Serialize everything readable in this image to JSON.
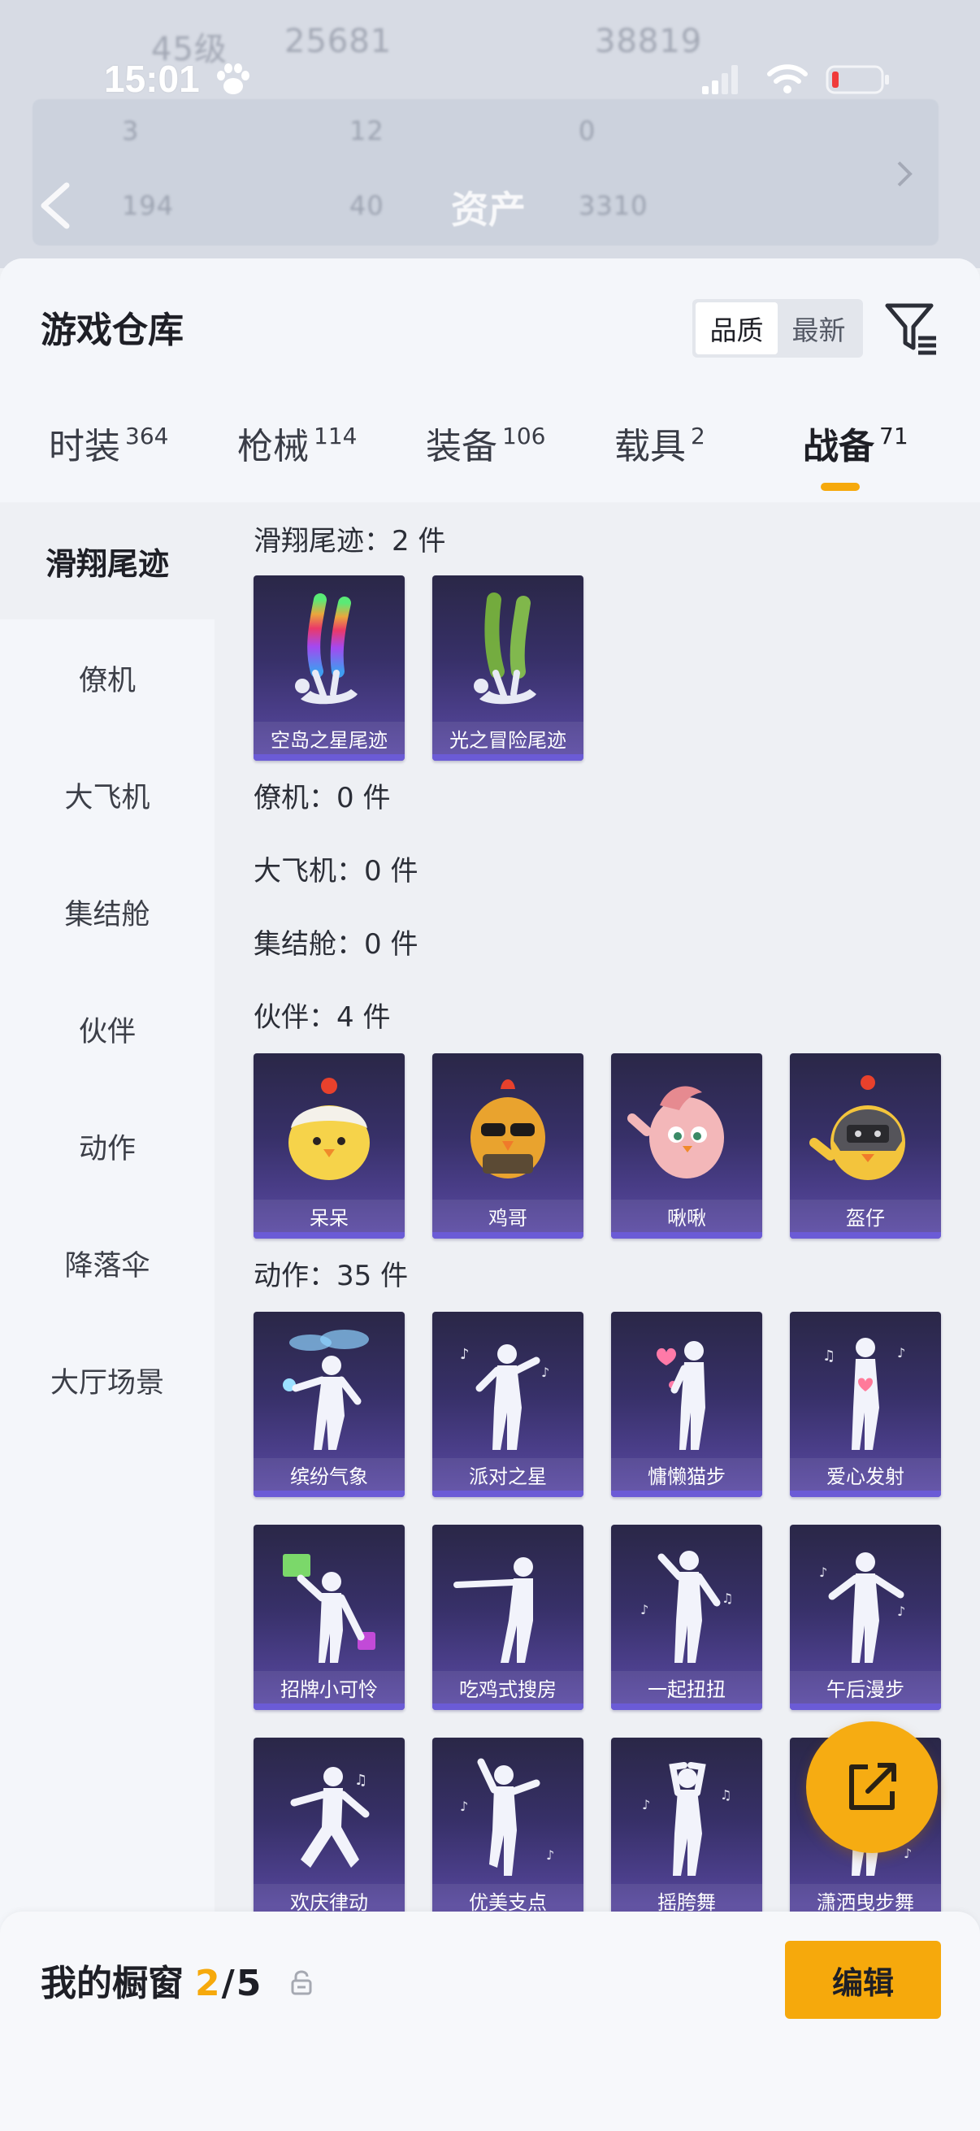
{
  "status_bar": {
    "time": "15:01"
  },
  "background_header": {
    "title": "资产",
    "ghost_texts": [
      "45级",
      "25681",
      "38819",
      "3",
      "12",
      "0",
      "194",
      "40",
      "3310"
    ]
  },
  "header": {
    "title": "游戏仓库",
    "sort_options": [
      {
        "label": "品质",
        "active": true
      },
      {
        "label": "最新",
        "active": false
      }
    ]
  },
  "tabs": [
    {
      "label": "时装",
      "count": "364",
      "active": false
    },
    {
      "label": "枪械",
      "count": "114",
      "active": false
    },
    {
      "label": "装备",
      "count": "106",
      "active": false
    },
    {
      "label": "载具",
      "count": "2",
      "active": false
    },
    {
      "label": "战备",
      "count": "71",
      "active": true
    }
  ],
  "sidebar": {
    "items": [
      {
        "label": "滑翔尾迹",
        "active": true
      },
      {
        "label": "僚机",
        "active": false
      },
      {
        "label": "大飞机",
        "active": false
      },
      {
        "label": "集结舱",
        "active": false
      },
      {
        "label": "伙伴",
        "active": false
      },
      {
        "label": "动作",
        "active": false
      },
      {
        "label": "降落伞",
        "active": false
      },
      {
        "label": "大厅场景",
        "active": false
      }
    ]
  },
  "sections": {
    "trail": {
      "title": "滑翔尾迹：2 件",
      "items": [
        "空岛之星尾迹",
        "光之冒险尾迹"
      ]
    },
    "wingman": {
      "title": "僚机：0 件"
    },
    "plane": {
      "title": "大飞机：0 件"
    },
    "pod": {
      "title": "集结舱：0 件"
    },
    "partner": {
      "title": "伙伴：4 件",
      "items": [
        "呆呆",
        "鸡哥",
        "啾啾",
        "盔仔"
      ]
    },
    "emote": {
      "title": "动作：35 件",
      "items": [
        "缤纷气象",
        "派对之星",
        "慵懒猫步",
        "爱心发射",
        "招牌小可怜",
        "吃鸡式搜房",
        "一起扭扭",
        "午后漫步",
        "欢庆律动",
        "优美支点",
        "摇胯舞",
        "潇洒曳步舞"
      ]
    }
  },
  "bottom_bar": {
    "label": "我的橱窗",
    "current": "2",
    "total": "5",
    "edit_label": "编辑"
  },
  "colors": {
    "accent": "#f6a90c",
    "card_bottom": "#6b5bd6",
    "card_top": "#2a2747"
  }
}
